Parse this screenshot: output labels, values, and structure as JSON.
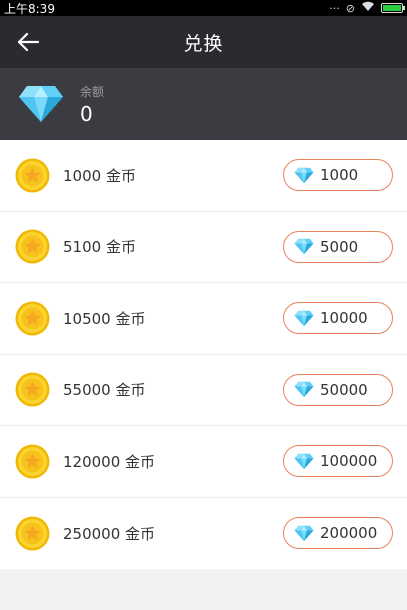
{
  "status_bar": {
    "time": "上午8:39"
  },
  "header": {
    "title": "兑换"
  },
  "balance": {
    "label": "余额",
    "value": "0"
  },
  "items": [
    {
      "coins": "1000 金币",
      "price": "1000"
    },
    {
      "coins": "5100 金币",
      "price": "5000"
    },
    {
      "coins": "10500 金币",
      "price": "10000"
    },
    {
      "coins": "55000 金币",
      "price": "50000"
    },
    {
      "coins": "120000 金币",
      "price": "100000"
    },
    {
      "coins": "250000 金币",
      "price": "200000"
    }
  ],
  "colors": {
    "accent_border": "#e8825a",
    "header_bg": "#2a2b2e",
    "balance_bg": "#3a3c41",
    "coin_gold": "#f7c21b",
    "diamond_blue": "#4cc6f0"
  },
  "icons": {
    "back": "arrow-left-icon",
    "diamond": "diamond-icon",
    "coin": "gold-coin-star-icon"
  }
}
